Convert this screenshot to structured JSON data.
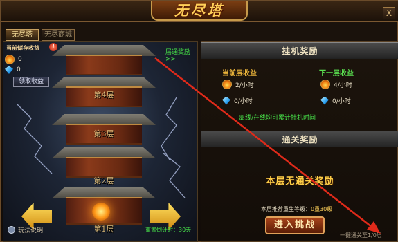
{
  "window": {
    "title": "无尽塔",
    "close_label": "X"
  },
  "tabs": [
    {
      "label": "无尽塔",
      "active": true
    },
    {
      "label": "无尽商城",
      "active": false
    }
  ],
  "tower": {
    "earnings_label": "当前储存收益",
    "fire_value": "0",
    "gem_value": "0",
    "claim_label": "领取收益",
    "ranking_link": "层通奖励>>",
    "floors": [
      "第4层",
      "第3层",
      "第2层",
      "第1层"
    ],
    "rules_label": "玩法说明",
    "reset_text": "重置倒计时：30天"
  },
  "afk_reward": {
    "title": "挂机奖励",
    "current": {
      "label": "当前层收益",
      "fire": "2/小时",
      "gem": "0/小时"
    },
    "next": {
      "label": "下一层收益",
      "fire": "4/小时",
      "gem": "0/小时"
    },
    "hint": "离线/在线均可累计挂机时间"
  },
  "clear_reward": {
    "title": "通关奖励",
    "no_reward": "本层无通关奖励",
    "recommend_label": "本层推荐重生等级：",
    "recommend_value": "0重30级",
    "enter_label": "进入挑战",
    "sweep_label": "一键通关至1/0层"
  },
  "colors": {
    "accent_gold": "#ffcf48",
    "link_green": "#48e64a",
    "fire": "#f07a10",
    "gem": "#2aa0f0"
  }
}
